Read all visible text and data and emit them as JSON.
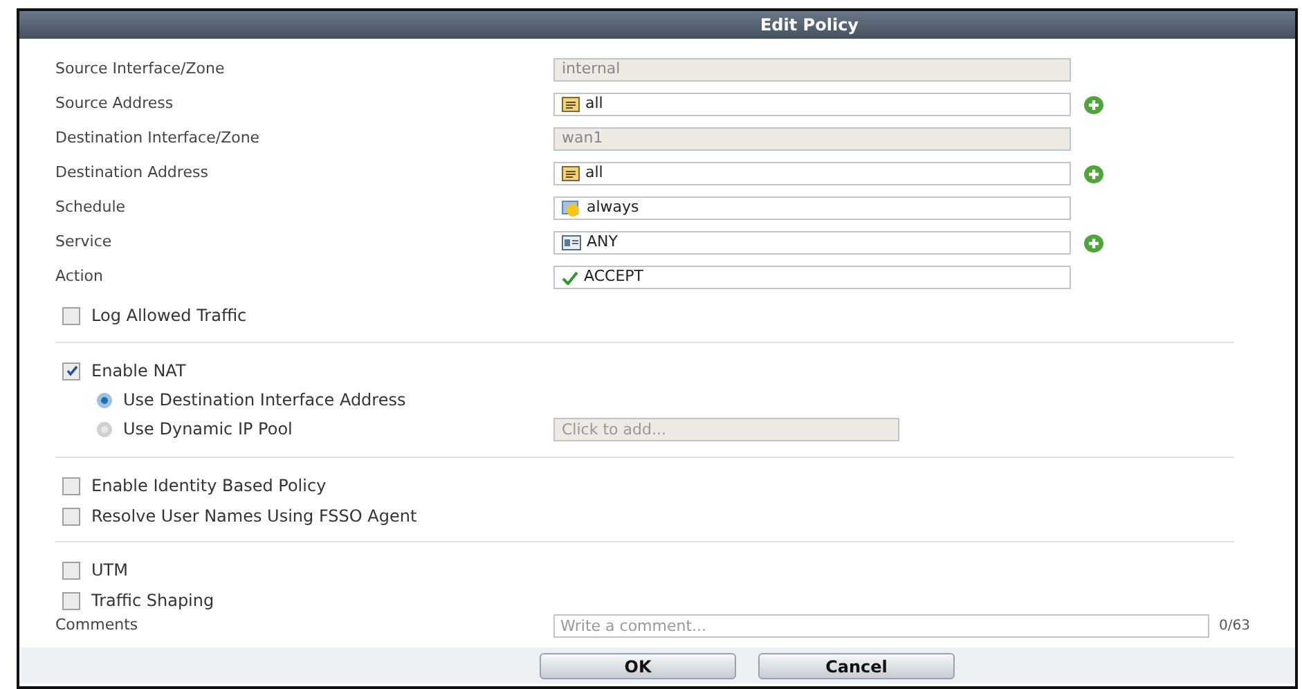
{
  "window": {
    "title": "Edit Policy"
  },
  "fields": [
    {
      "label": "Source Interface/Zone",
      "value": "internal",
      "kind": "readonly",
      "add": false
    },
    {
      "label": "Source Address",
      "value": "all",
      "kind": "address",
      "add": true
    },
    {
      "label": "Destination Interface/Zone",
      "value": "wan1",
      "kind": "readonly",
      "add": false
    },
    {
      "label": "Destination Address",
      "value": "all",
      "kind": "address",
      "add": true
    },
    {
      "label": "Schedule",
      "value": "always",
      "kind": "schedule",
      "add": false
    },
    {
      "label": "Service",
      "value": "ANY",
      "kind": "service",
      "add": true
    },
    {
      "label": "Action",
      "value": "ACCEPT",
      "kind": "action",
      "add": false
    }
  ],
  "log_allowed_traffic": {
    "label": "Log Allowed Traffic",
    "checked": false
  },
  "nat": {
    "label": "Enable NAT",
    "checked": true,
    "options": [
      {
        "label": "Use Destination Interface Address",
        "selected": true
      },
      {
        "label": "Use Dynamic IP Pool",
        "selected": false
      }
    ],
    "pool_placeholder": "Click to add..."
  },
  "identity_options": [
    {
      "label": "Enable Identity Based Policy",
      "checked": false
    },
    {
      "label": "Resolve User Names Using FSSO Agent",
      "checked": false
    }
  ],
  "extra_options": [
    {
      "label": "UTM",
      "checked": false
    },
    {
      "label": "Traffic Shaping",
      "checked": false
    }
  ],
  "comments": {
    "label": "Comments",
    "placeholder": "Write a comment...",
    "counter": "0/63"
  },
  "buttons": [
    {
      "label": "OK"
    },
    {
      "label": "Cancel"
    }
  ]
}
